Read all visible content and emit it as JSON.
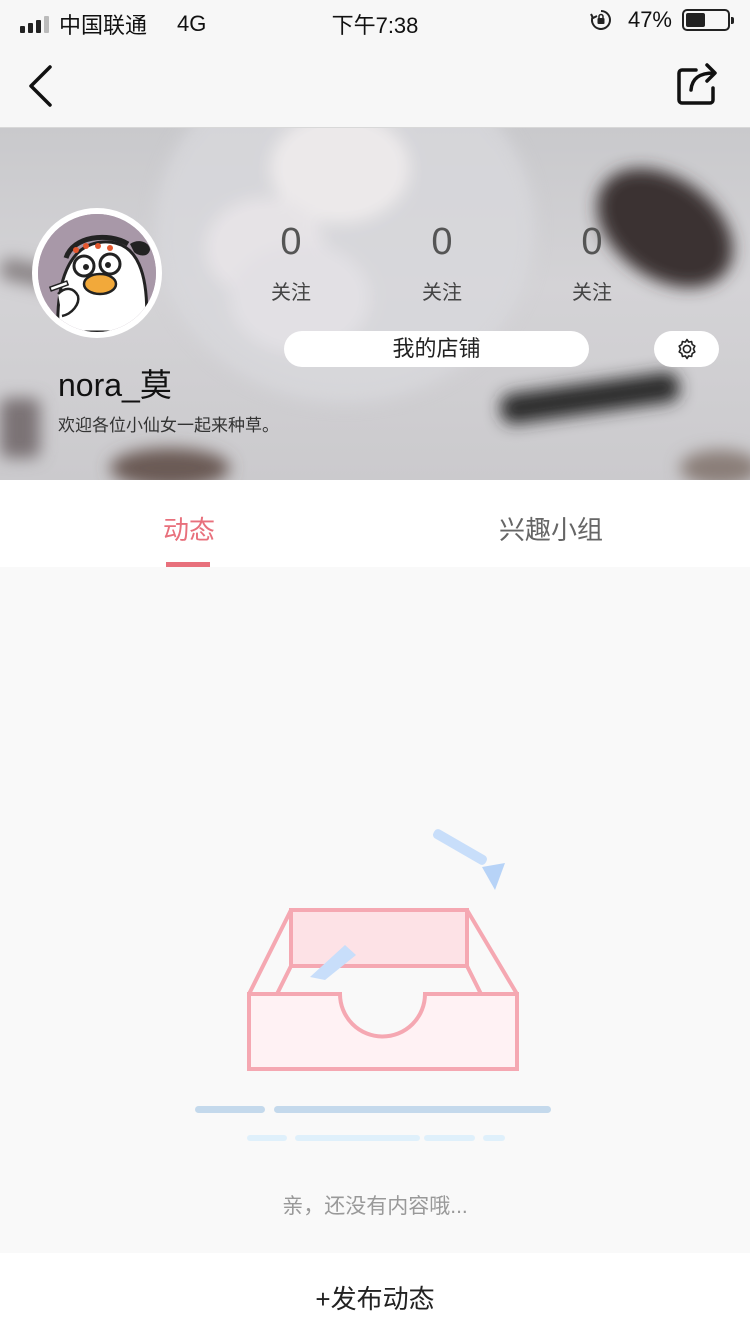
{
  "status_bar": {
    "carrier": "中国联通",
    "network": "4G",
    "time": "下午7:38",
    "battery": "47%",
    "battery_level": 0.47
  },
  "nav": {
    "back_icon": "chevron-left-icon",
    "share_icon": "share-icon"
  },
  "profile": {
    "username": "nora_莫",
    "bio": "欢迎各位小仙女一起来种草。",
    "stats": [
      {
        "value": "0",
        "label": "关注"
      },
      {
        "value": "0",
        "label": "关注"
      },
      {
        "value": "0",
        "label": "关注"
      }
    ],
    "shop_button": "我的店铺",
    "settings_icon": "gear-icon"
  },
  "tabs": [
    {
      "label": "动态",
      "active": true
    },
    {
      "label": "兴趣小组",
      "active": false
    }
  ],
  "empty_state": {
    "message": "亲，还没有内容哦..."
  },
  "bottom_action": {
    "label": "+发布动态"
  },
  "colors": {
    "accent": "#e8707c",
    "box_stroke": "#f5a8b2",
    "line_blue": "#c4d9ec"
  }
}
